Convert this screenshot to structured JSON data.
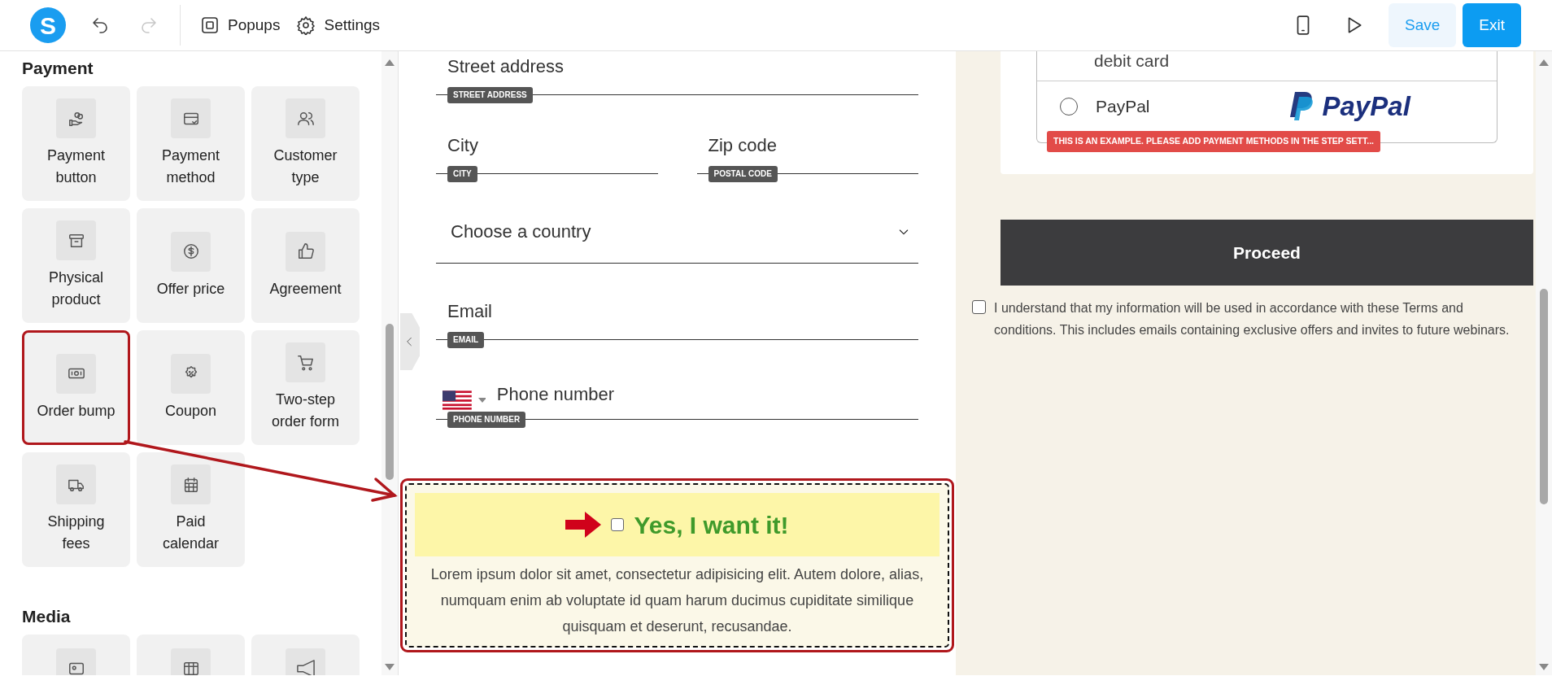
{
  "toolbar": {
    "logo": "S",
    "history": [
      {
        "kind": "undo",
        "disabled": false
      },
      {
        "kind": "redo",
        "disabled": true
      }
    ],
    "menu": [
      {
        "label": "Popups",
        "kind": "popups"
      },
      {
        "label": "Settings",
        "kind": "settings"
      }
    ],
    "preview": [
      {
        "kind": "phone"
      },
      {
        "kind": "play"
      }
    ],
    "buttons": [
      {
        "label": "Save",
        "kind": "secondary"
      },
      {
        "label": "Exit",
        "kind": "primary"
      }
    ]
  },
  "sidebar": {
    "sections": [
      {
        "title": "Payment",
        "items": [
          {
            "label": "Payment button",
            "kind": "hand-coins",
            "highlighted": false
          },
          {
            "label": "Payment method",
            "kind": "card",
            "highlighted": false
          },
          {
            "label": "Customer type",
            "kind": "users",
            "highlighted": false
          },
          {
            "label": "Physical product",
            "kind": "box",
            "highlighted": false
          },
          {
            "label": "Offer price",
            "kind": "dollar",
            "highlighted": false
          },
          {
            "label": "Agreement",
            "kind": "thumb",
            "highlighted": false
          },
          {
            "label": "Order bump",
            "kind": "banknote",
            "highlighted": true
          },
          {
            "label": "Coupon",
            "kind": "percent",
            "highlighted": false
          },
          {
            "label": "Two-step order form",
            "kind": "cart",
            "highlighted": false
          },
          {
            "label": "Shipping fees",
            "kind": "truck",
            "highlighted": false
          },
          {
            "label": "Paid calendar",
            "kind": "calendar",
            "highlighted": false
          }
        ]
      },
      {
        "title": "Media",
        "items": [
          {
            "kind": "image",
            "highlighted": false
          },
          {
            "kind": "table",
            "highlighted": false
          },
          {
            "kind": "speaker",
            "highlighted": false
          }
        ]
      }
    ]
  },
  "form": {
    "rows": [
      [
        {
          "kind": "text",
          "placeholder": "Street address",
          "tag": "STREET ADDRESS"
        }
      ],
      [
        {
          "kind": "text",
          "placeholder": "City",
          "tag": "CITY"
        },
        {
          "kind": "text",
          "placeholder": "Zip code",
          "tag": "POSTAL CODE"
        }
      ],
      [
        {
          "kind": "select",
          "placeholder": "Choose a country"
        }
      ],
      [
        {
          "kind": "text",
          "placeholder": "Email",
          "tag": "EMAIL"
        }
      ],
      [
        {
          "kind": "phone",
          "placeholder": "Phone number",
          "tag": "PHONE NUMBER"
        }
      ]
    ]
  },
  "order_bump": {
    "highlighted": true,
    "checked": false,
    "headline": "Yes, I want it!",
    "description": "Lorem ipsum dolor sit amet, consectetur adipisicing elit. Autem dolore, alias, numquam enim ab voluptate id quam harum ducimus cupiditate similique quisquam et deserunt, recusandae."
  },
  "payment": {
    "partial_method": "debit card",
    "methods": [
      {
        "label": "PayPal",
        "logo_text": "PayPal",
        "selected": false
      }
    ],
    "notice": "THIS IS AN EXAMPLE. PLEASE ADD PAYMENT METHODS IN THE STEP SETT..."
  },
  "proceed": "Proceed",
  "terms": {
    "checked": false,
    "text": "I understand that my information will be used in accordance with these Terms and conditions. This includes emails containing exclusive offers and invites to future webinars."
  }
}
